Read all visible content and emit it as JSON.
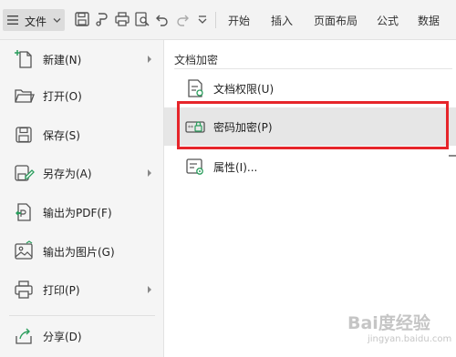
{
  "toolbar": {
    "file_label": "文件",
    "tabs": [
      "开始",
      "插入",
      "页面布局",
      "公式",
      "数据"
    ]
  },
  "left_menu": {
    "items": [
      {
        "label": "新建(N)",
        "icon": "new-doc-icon",
        "has_submenu": true
      },
      {
        "label": "打开(O)",
        "icon": "folder-open-icon",
        "has_submenu": false
      },
      {
        "label": "保存(S)",
        "icon": "save-icon",
        "has_submenu": false
      },
      {
        "label": "另存为(A)",
        "icon": "save-as-icon",
        "has_submenu": true
      },
      {
        "label": "输出为PDF(F)",
        "icon": "pdf-export-icon",
        "has_submenu": false
      },
      {
        "label": "输出为图片(G)",
        "icon": "image-export-icon",
        "has_submenu": false
      },
      {
        "label": "打印(P)",
        "icon": "printer-icon",
        "has_submenu": true
      },
      {
        "label": "分享(D)",
        "icon": "share-icon",
        "has_submenu": false
      }
    ]
  },
  "encrypt_panel": {
    "title": "文档加密",
    "items": [
      {
        "label": "文档权限(U)",
        "icon": "document-permission-icon"
      },
      {
        "label": "密码加密(P)",
        "icon": "password-lock-icon",
        "highlighted": true
      },
      {
        "label": "属性(I)...",
        "icon": "properties-gear-icon"
      }
    ]
  },
  "watermark": {
    "main": "Bai度经验",
    "sub": "jingyan.baidu.com"
  },
  "colors": {
    "highlight_border": "#e6252a",
    "menu_bg": "#f5f5f5",
    "hover_bg": "#e6e6e6"
  }
}
